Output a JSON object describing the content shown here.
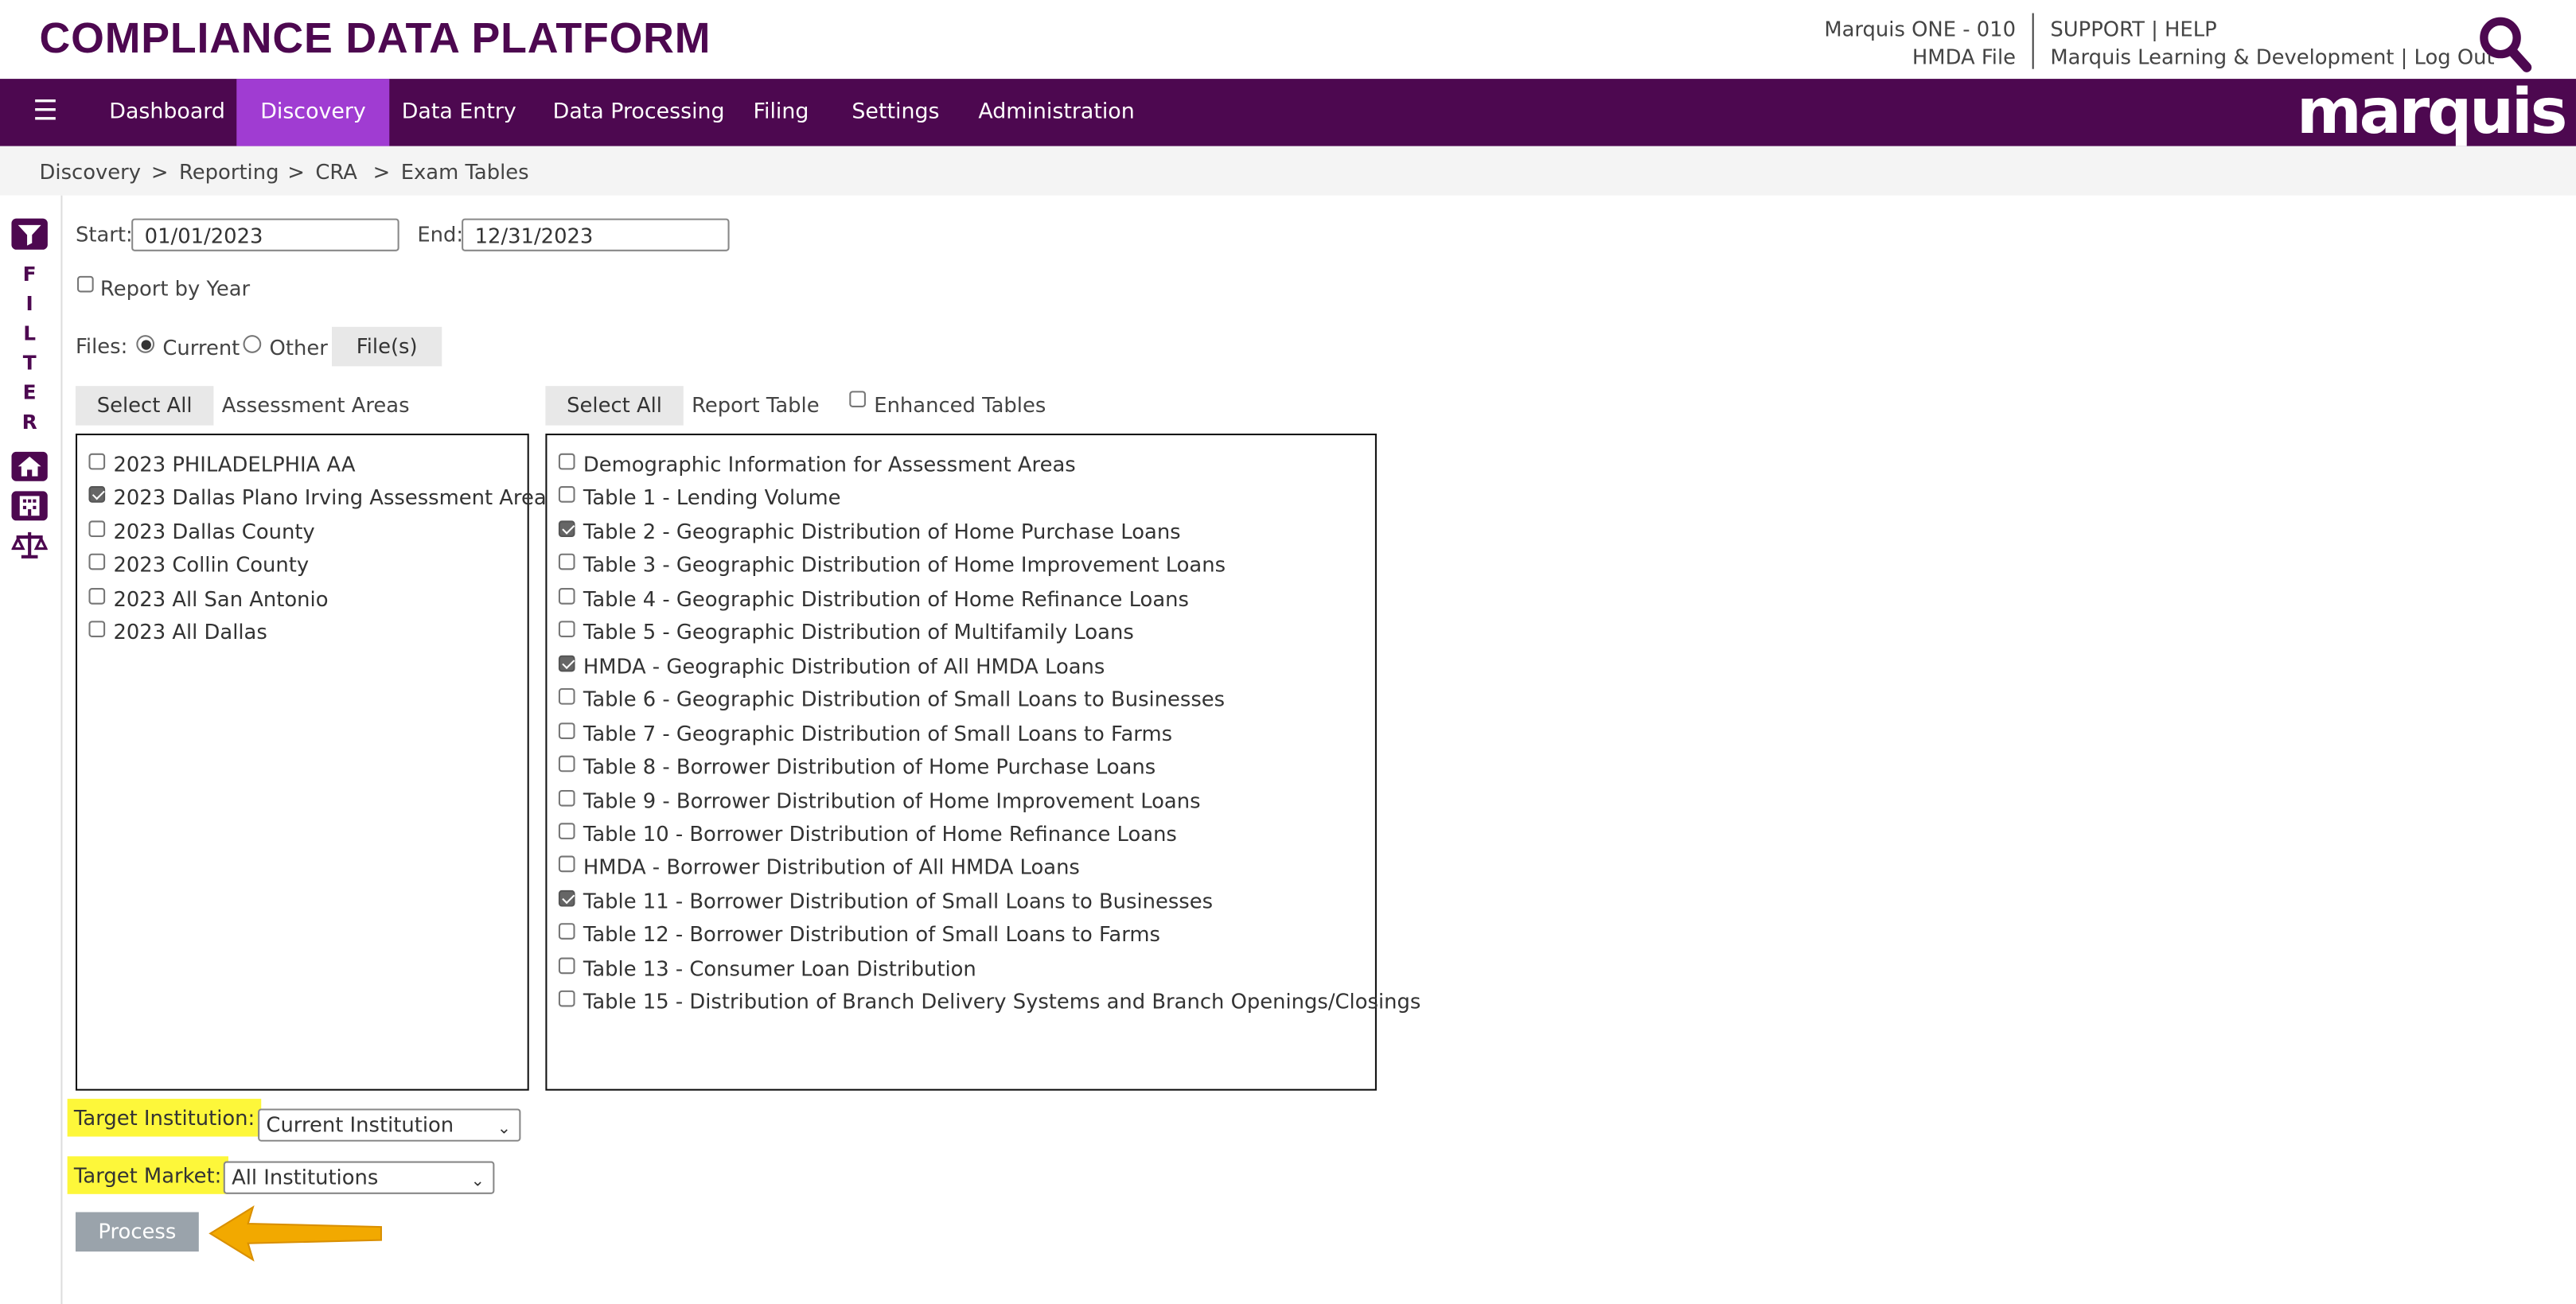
{
  "header": {
    "app_title": "COMPLIANCE DATA PLATFORM",
    "institution": "Marquis ONE - 010",
    "file": "HMDA File",
    "support": "SUPPORT | HELP",
    "user_links": "Marquis Learning & Development | Log Out",
    "brand": "marquis"
  },
  "nav": {
    "items": [
      "Dashboard",
      "Discovery",
      "Data Entry",
      "Data Processing",
      "Filing",
      "Settings",
      "Administration"
    ],
    "active": "Discovery"
  },
  "breadcrumb": [
    "Discovery",
    "Reporting",
    "CRA",
    "Exam Tables"
  ],
  "breadcrumb_sep": ">",
  "filter_rail": {
    "letters": [
      "F",
      "I",
      "L",
      "T",
      "E",
      "R"
    ]
  },
  "form": {
    "start_label": "Start:",
    "start_value": "01/01/2023",
    "end_label": "End:",
    "end_value": "12/31/2023",
    "report_by_year_label": "Report by Year",
    "report_by_year_checked": false,
    "files_label": "Files:",
    "files_current": "Current",
    "files_other": "Other",
    "files_selected": "Current",
    "files_button": "File(s)",
    "select_all": "Select All",
    "assessment_areas_label": "Assessment Areas",
    "report_table_label": "Report Table",
    "enhanced_tables_label": "Enhanced Tables",
    "enhanced_tables_checked": false,
    "assessment_areas": [
      {
        "label": "2023 PHILADELPHIA AA",
        "checked": false
      },
      {
        "label": "2023 Dallas Plano Irving Assessment Area",
        "checked": true
      },
      {
        "label": "2023 Dallas County",
        "checked": false
      },
      {
        "label": "2023 Collin County",
        "checked": false
      },
      {
        "label": "2023 All San Antonio",
        "checked": false
      },
      {
        "label": "2023 All Dallas",
        "checked": false
      }
    ],
    "report_tables": [
      {
        "label": "Demographic Information for Assessment Areas",
        "checked": false
      },
      {
        "label": "Table 1 - Lending Volume",
        "checked": false
      },
      {
        "label": "Table 2 - Geographic Distribution of Home Purchase Loans",
        "checked": true
      },
      {
        "label": "Table 3 - Geographic Distribution of Home Improvement Loans",
        "checked": false
      },
      {
        "label": "Table 4 - Geographic Distribution of Home Refinance Loans",
        "checked": false
      },
      {
        "label": "Table 5 - Geographic Distribution of Multifamily Loans",
        "checked": false
      },
      {
        "label": "HMDA - Geographic Distribution of All HMDA Loans",
        "checked": true
      },
      {
        "label": "Table 6 - Geographic Distribution of Small Loans to Businesses",
        "checked": false
      },
      {
        "label": "Table 7 - Geographic Distribution of Small Loans to Farms",
        "checked": false
      },
      {
        "label": "Table 8 - Borrower Distribution of Home Purchase Loans",
        "checked": false
      },
      {
        "label": "Table 9 - Borrower Distribution of Home Improvement Loans",
        "checked": false
      },
      {
        "label": "Table 10 - Borrower Distribution of Home Refinance Loans",
        "checked": false
      },
      {
        "label": "HMDA - Borrower Distribution of All HMDA Loans",
        "checked": false
      },
      {
        "label": "Table 11 - Borrower Distribution of Small Loans to Businesses",
        "checked": true
      },
      {
        "label": "Table 12 - Borrower Distribution of Small Loans to Farms",
        "checked": false
      },
      {
        "label": "Table 13 - Consumer Loan Distribution",
        "checked": false
      },
      {
        "label": "Table 15 - Distribution of Branch Delivery Systems and Branch Openings/Closings",
        "checked": false
      }
    ],
    "target_institution_label": "Target Institution:",
    "target_institution_value": "Current Institution",
    "target_market_label": "Target Market:",
    "target_market_value": "All Institutions",
    "process_button": "Process"
  },
  "colors": {
    "brand_purple": "#4d0850",
    "nav_active": "#a03cd2",
    "highlight": "#fdf73a",
    "arrow": "#f2a900"
  }
}
